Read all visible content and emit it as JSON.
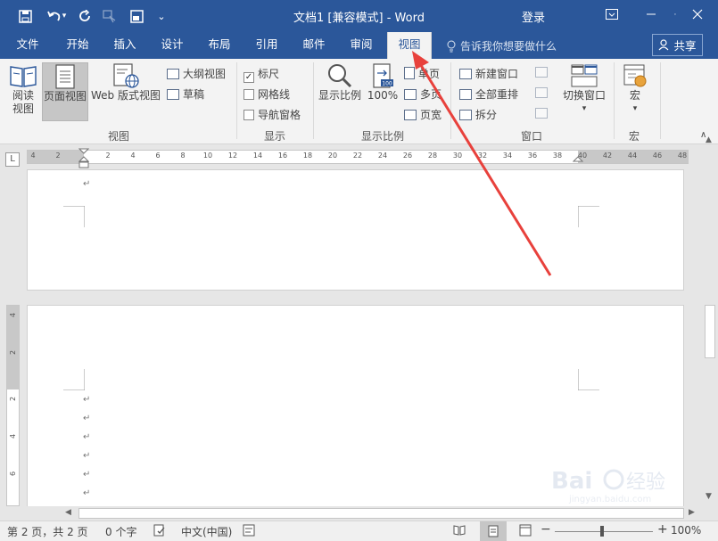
{
  "window": {
    "title": "文档1 [兼容模式] - Word",
    "login": "登录"
  },
  "tabs": [
    {
      "label": "文件"
    },
    {
      "label": "开始"
    },
    {
      "label": "插入"
    },
    {
      "label": "设计"
    },
    {
      "label": "布局"
    },
    {
      "label": "引用"
    },
    {
      "label": "邮件"
    },
    {
      "label": "审阅"
    },
    {
      "label": "视图"
    }
  ],
  "active_tab": "视图",
  "tell_me": "告诉我你想要做什么",
  "share": "共享",
  "ribbon": {
    "views": {
      "read_mode": "阅读视图",
      "print_layout": "页面视图",
      "web_layout": "Web 版式视图",
      "outline": "大纲视图",
      "draft": "草稿",
      "group": "视图"
    },
    "show": {
      "ruler": "标尺",
      "gridlines": "网格线",
      "navigation": "导航窗格",
      "group": "显示",
      "ruler_checked": true,
      "gridlines_checked": false,
      "navigation_checked": false
    },
    "zoom": {
      "zoom": "显示比例",
      "hundred": "100%",
      "one_page": "单页",
      "multi_page": "多页",
      "page_width": "页宽",
      "group": "显示比例"
    },
    "window": {
      "new_window": "新建窗口",
      "arrange_all": "全部重排",
      "split": "拆分",
      "switch": "切换窗口",
      "group": "窗口"
    },
    "macros": {
      "label": "宏",
      "group": "宏"
    }
  },
  "ruler_ticks": [
    "4",
    "2",
    "2",
    "4",
    "6",
    "8",
    "10",
    "12",
    "14",
    "16",
    "18",
    "20",
    "22",
    "24",
    "26",
    "28",
    "30",
    "32",
    "34",
    "36",
    "38",
    "40",
    "42",
    "44",
    "46",
    "48"
  ],
  "vruler_ticks": [
    "4",
    "2",
    "2",
    "4",
    "6"
  ],
  "status": {
    "page": "第 2 页，共 2 页",
    "words": "0 个字",
    "language": "中文(中国)",
    "zoom": "100%"
  },
  "watermark": "Baidu经验 jingyan.baidu.com",
  "colors": {
    "brand": "#2b579a",
    "arrow": "#e8413c"
  }
}
